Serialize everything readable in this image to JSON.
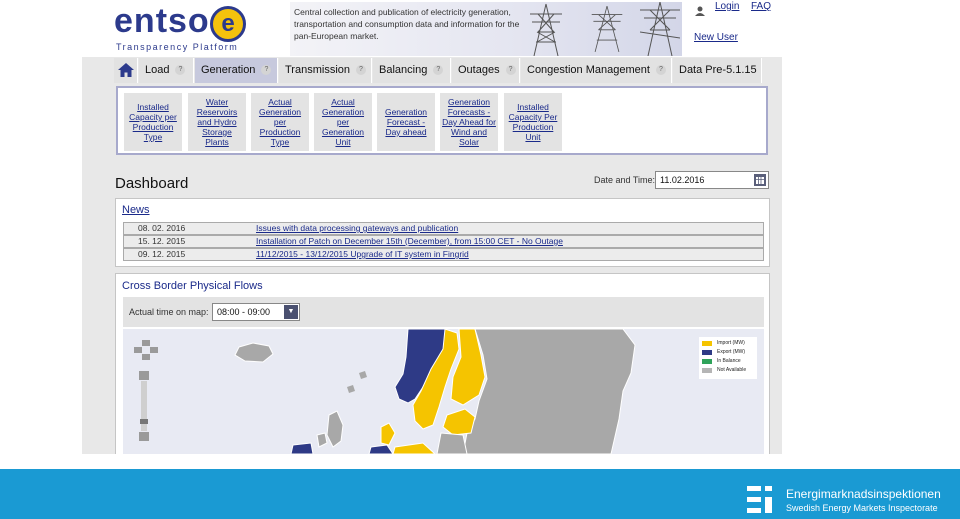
{
  "header": {
    "logo_word": "ntso",
    "logo_first": "e",
    "logo_last": "e",
    "logo_sub": "Transparency Platform",
    "banner_text": "Central collection and publication of electricity generation, transportation and consumption data and information for the pan-European market.",
    "login": "Login",
    "faq": "FAQ",
    "new_user": "New User"
  },
  "nav": {
    "tabs": [
      {
        "label": "Load"
      },
      {
        "label": "Generation"
      },
      {
        "label": "Transmission"
      },
      {
        "label": "Balancing"
      },
      {
        "label": "Outages"
      },
      {
        "label": "Congestion Management"
      },
      {
        "label": "Data Pre-5.1.15"
      }
    ],
    "active": "Generation",
    "help_glyph": "?"
  },
  "subnav": {
    "items": [
      {
        "label": "Installed Capacity per Production Type"
      },
      {
        "label": "Water Reservoirs and Hydro Storage Plants"
      },
      {
        "label": "Actual Generation per Production Type"
      },
      {
        "label": "Actual Generation per Generation Unit"
      },
      {
        "label": "Generation Forecast - Day ahead"
      },
      {
        "label": "Generation Forecasts - Day Ahead for Wind and Solar"
      },
      {
        "label": "Installed Capacity Per Production Unit"
      }
    ]
  },
  "dashboard": {
    "title": "Dashboard",
    "date_label": "Date and Time:",
    "date_value": "11.02.2016"
  },
  "news": {
    "title": "News",
    "items": [
      {
        "date": "08. 02. 2016",
        "text": "Issues with data processing gateways and publication"
      },
      {
        "date": "15. 12. 2015",
        "text": "Installation of Patch on December 15th (December), from 15:00 CET - No Outage"
      },
      {
        "date": "09. 12. 2015",
        "text": "11/12/2015 - 13/12/2015 Upgrade of IT system in Fingrid"
      }
    ]
  },
  "flows": {
    "title": "Cross Border Physical Flows",
    "time_label": "Actual time on map:",
    "time_value": "08:00 - 09:00",
    "legend": [
      {
        "label": "Import (MW)",
        "color": "#f5c400"
      },
      {
        "label": "Export (MW)",
        "color": "#2e3a86"
      },
      {
        "label": "In Balance",
        "color": "#2fa35a"
      },
      {
        "label": "Not Available",
        "color": "#b5b5b5"
      }
    ]
  },
  "colors": {
    "import": "#f5c400",
    "export": "#2e3a86",
    "not_available": "#a8a8a8",
    "brand": "#2c3a8c",
    "footer_bg": "#1a9ad3"
  },
  "footer": {
    "name": "Energimarknadsinspektionen",
    "sub": "Swedish Energy Markets Inspectorate"
  }
}
